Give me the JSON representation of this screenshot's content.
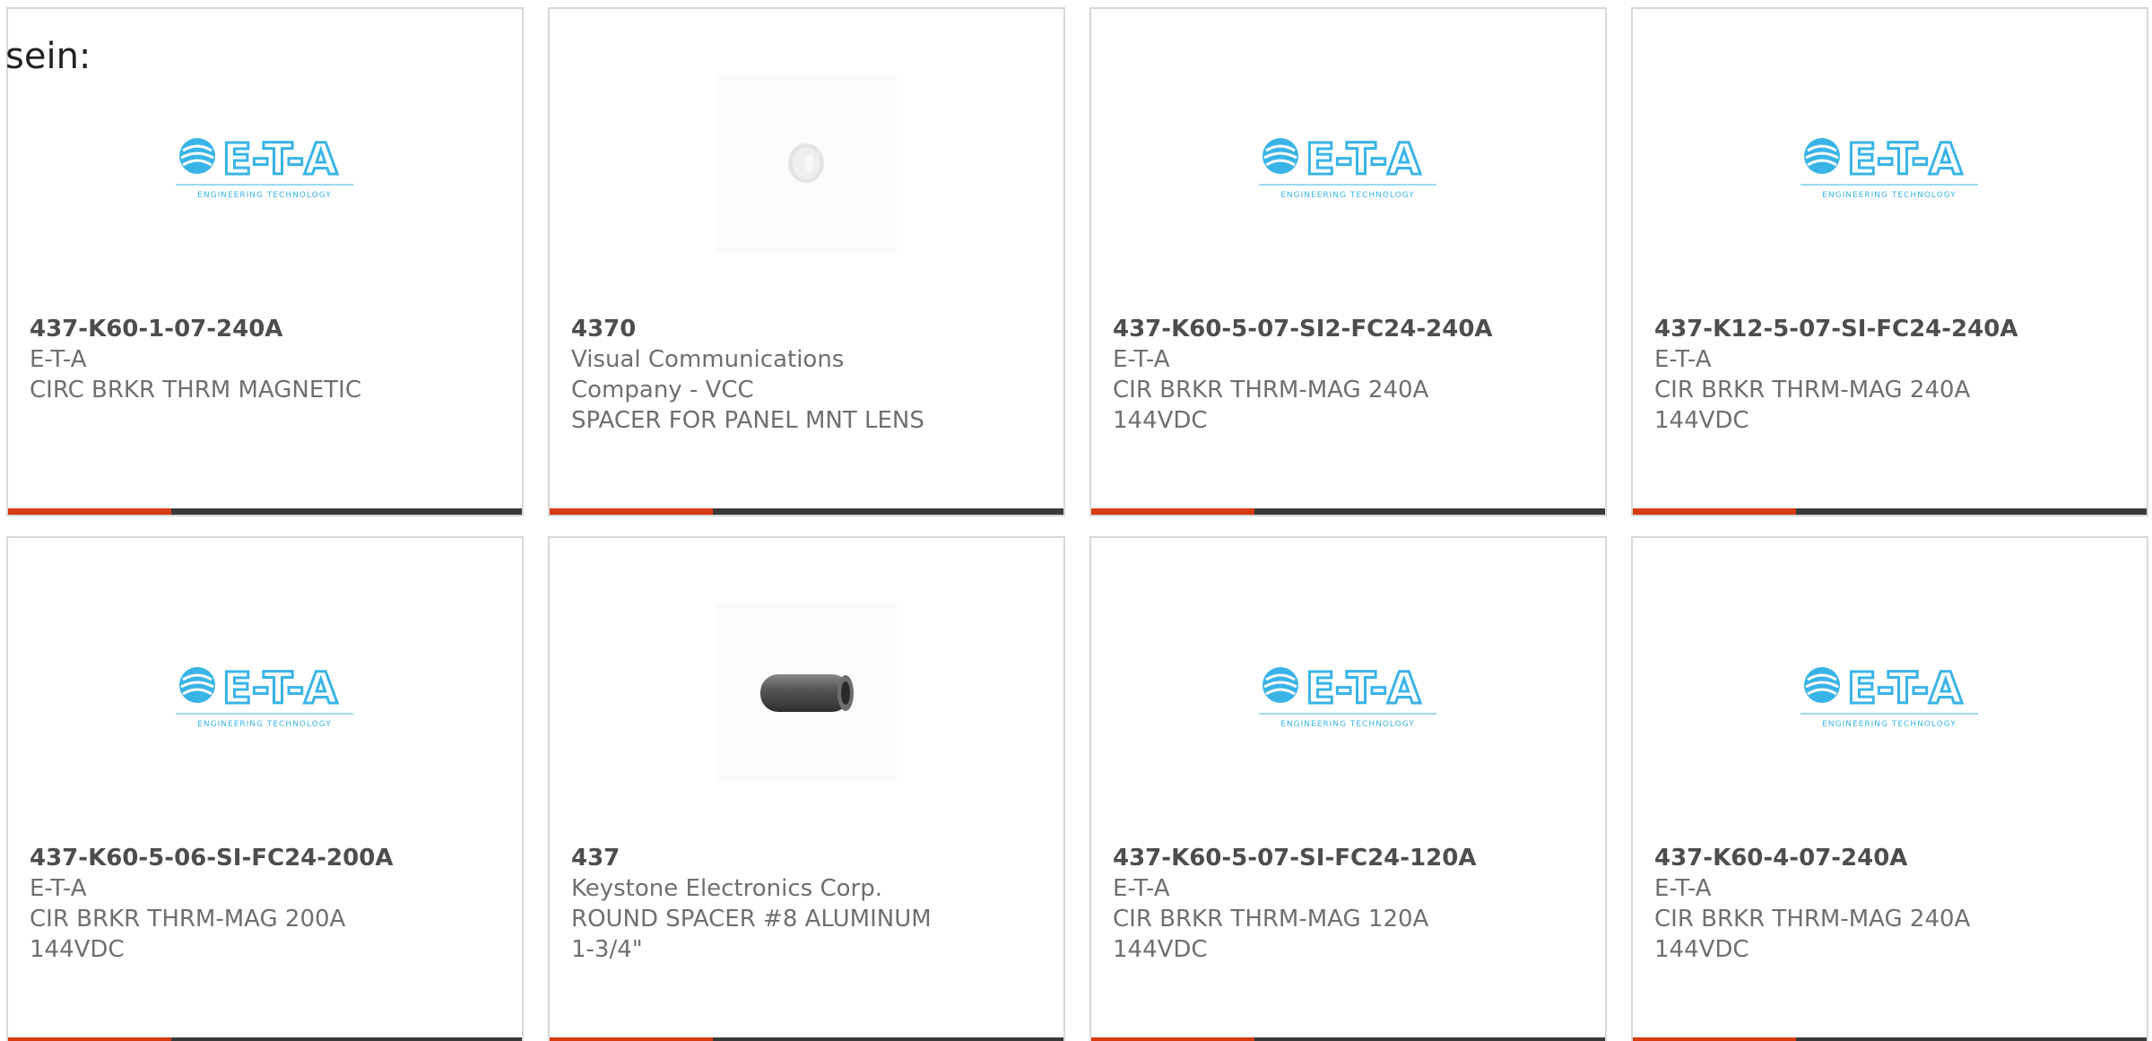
{
  "intro_text": "sein:",
  "colors": {
    "accent": "#d63a10",
    "bar_dark": "#3a3a3a",
    "eta_blue": "#3ab4e6"
  },
  "cards": [
    {
      "part": "437-K60-1-07-240A",
      "manufacturer": "E-T-A",
      "description": "CIRC BRKR THRM MAGNETIC",
      "image": "eta-logo",
      "logo_text": "E-T-A",
      "logo_tagline": "ENGINEERING TECHNOLOGY"
    },
    {
      "part": "4370",
      "manufacturer": "Visual Communications Company - VCC",
      "description": "SPACER FOR PANEL MNT LENS",
      "image": "white-spacer"
    },
    {
      "part": "437-K60-5-07-SI2-FC24-240A",
      "manufacturer": "E-T-A",
      "description": "CIR BRKR THRM-MAG 240A 144VDC",
      "image": "eta-logo",
      "logo_text": "E-T-A",
      "logo_tagline": "ENGINEERING TECHNOLOGY"
    },
    {
      "part": "437-K12-5-07-SI-FC24-240A",
      "manufacturer": "E-T-A",
      "description": "CIR BRKR THRM-MAG 240A 144VDC",
      "image": "eta-logo",
      "logo_text": "E-T-A",
      "logo_tagline": "ENGINEERING TECHNOLOGY"
    },
    {
      "part": "437-K60-5-06-SI-FC24-200A",
      "manufacturer": "E-T-A",
      "description": "CIR BRKR THRM-MAG 200A 144VDC",
      "image": "eta-logo",
      "logo_text": "E-T-A",
      "logo_tagline": "ENGINEERING TECHNOLOGY"
    },
    {
      "part": "437",
      "manufacturer": "Keystone Electronics Corp.",
      "description": "ROUND SPACER #8 ALUMINUM 1-3/4\"",
      "image": "aluminum-spacer"
    },
    {
      "part": "437-K60-5-07-SI-FC24-120A",
      "manufacturer": "E-T-A",
      "description": "CIR BRKR THRM-MAG 120A 144VDC",
      "image": "eta-logo",
      "logo_text": "E-T-A",
      "logo_tagline": "ENGINEERING TECHNOLOGY"
    },
    {
      "part": "437-K60-4-07-240A",
      "manufacturer": "E-T-A",
      "description": "CIR BRKR THRM-MAG 240A 144VDC",
      "image": "eta-logo",
      "logo_text": "E-T-A",
      "logo_tagline": "ENGINEERING TECHNOLOGY"
    }
  ]
}
